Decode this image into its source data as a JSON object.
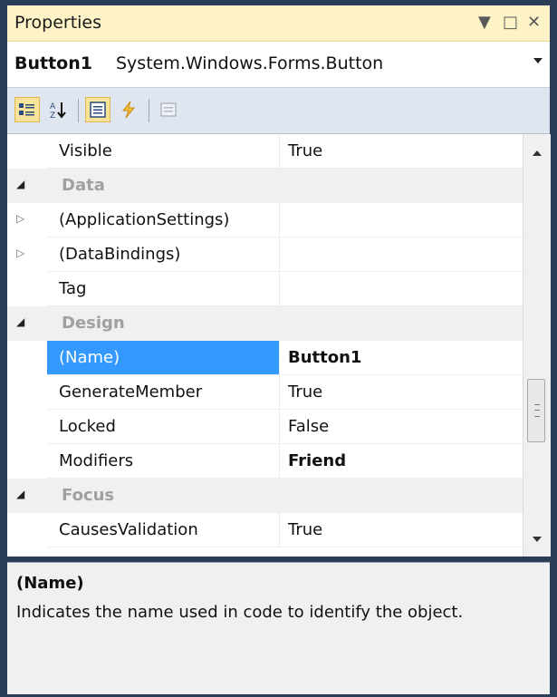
{
  "window": {
    "title": "Properties",
    "controls": [
      "▼",
      "□",
      "✕"
    ]
  },
  "object_selector": {
    "name": "Button1",
    "type": "System.Windows.Forms.Button"
  },
  "toolbar": {
    "buttons": [
      {
        "name": "categorized-icon",
        "active": true
      },
      {
        "name": "alphabetical-icon",
        "active": false
      },
      {
        "name": "properties-icon",
        "active": true
      },
      {
        "name": "events-icon",
        "active": false
      },
      {
        "name": "property-pages-icon",
        "active": false,
        "disabled": true
      }
    ]
  },
  "grid": {
    "rows": [
      {
        "kind": "prop",
        "name": "Visible",
        "value": "True"
      },
      {
        "kind": "cat",
        "name": "Data"
      },
      {
        "kind": "prop",
        "name": "(ApplicationSettings)",
        "value": "",
        "expandable": true
      },
      {
        "kind": "prop",
        "name": "(DataBindings)",
        "value": "",
        "expandable": true
      },
      {
        "kind": "prop",
        "name": "Tag",
        "value": ""
      },
      {
        "kind": "cat",
        "name": "Design"
      },
      {
        "kind": "prop",
        "name": "(Name)",
        "value": "Button1",
        "bold": true,
        "selected": true
      },
      {
        "kind": "prop",
        "name": "GenerateMember",
        "value": "True"
      },
      {
        "kind": "prop",
        "name": "Locked",
        "value": "False"
      },
      {
        "kind": "prop",
        "name": "Modifiers",
        "value": "Friend",
        "bold": true
      },
      {
        "kind": "cat",
        "name": "Focus"
      },
      {
        "kind": "prop",
        "name": "CausesValidation",
        "value": "True"
      }
    ]
  },
  "description": {
    "title": "(Name)",
    "text": "Indicates the name used in code to identify the object."
  }
}
